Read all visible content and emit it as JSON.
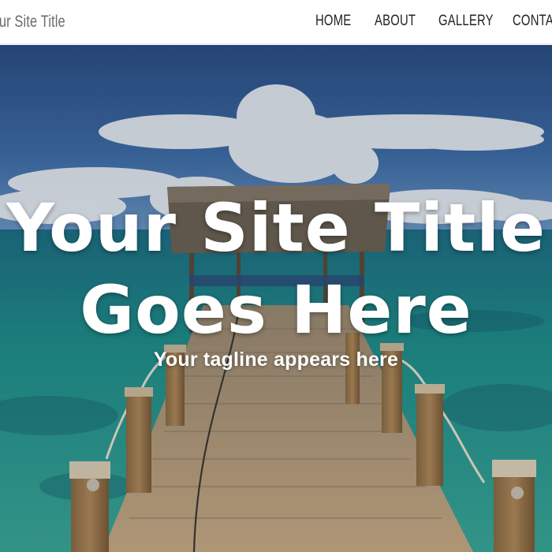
{
  "header": {
    "site_title": "Your Site Title",
    "nav": {
      "home": "HOME",
      "about": "ABOUT",
      "gallery": "GALLERY",
      "contact": "CONTACT"
    }
  },
  "hero": {
    "title_line1": "Your Site Title",
    "title_line2": "Goes Here",
    "tagline": "Your tagline appears here",
    "image": "tropical-pier-hut-ocean"
  },
  "colors": {
    "header_bg": "#ffffff",
    "nav_text": "#222222",
    "site_title_text": "#6b6b6b",
    "hero_text": "#ffffff"
  }
}
